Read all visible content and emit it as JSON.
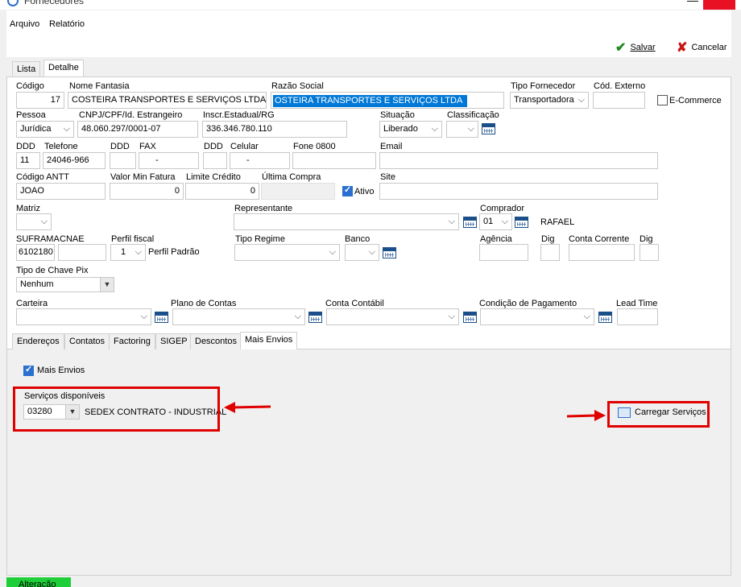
{
  "window": {
    "title": "Fornecedores"
  },
  "menu": [
    "Arquivo",
    "Relatório"
  ],
  "toolbar": {
    "save": "Salvar",
    "cancel": "Cancelar"
  },
  "main_tabs": [
    "Lista",
    "Detalhe"
  ],
  "fields": {
    "codigo": {
      "label": "Código",
      "value": "17"
    },
    "nome_fantasia": {
      "label": "Nome Fantasia",
      "value": "COSTEIRA TRANSPORTES E SERVIÇOS LTDA"
    },
    "razao_social": {
      "label": "Razão Social",
      "value": "OSTEIRA TRANSPORTES E SERVIÇOS LTDA"
    },
    "tipo_fornecedor": {
      "label": "Tipo Fornecedor",
      "value": "Transportadora"
    },
    "cod_externo": {
      "label": "Cód. Externo",
      "value": ""
    },
    "ecommerce": {
      "label": "E-Commerce",
      "checked": false
    },
    "pessoa": {
      "label": "Pessoa",
      "value": "Jurídica"
    },
    "cnpj": {
      "label": "CNPJ/CPF/Id. Estrangeiro",
      "value": "48.060.297/0001-07"
    },
    "inscr": {
      "label": "Inscr.Estadual/RG",
      "value": "336.346.780.110"
    },
    "situacao": {
      "label": "Situação",
      "value": "Liberado"
    },
    "classificacao": {
      "label": "Classificação",
      "value": ""
    },
    "ddd1": {
      "label": "DDD",
      "value": "11"
    },
    "telefone": {
      "label": "Telefone",
      "value": "24046-966"
    },
    "ddd2": {
      "label": "DDD",
      "value": ""
    },
    "fax": {
      "label": "FAX",
      "value": "-"
    },
    "ddd3": {
      "label": "DDD",
      "value": ""
    },
    "celular": {
      "label": "Celular",
      "value": "-"
    },
    "fone0800": {
      "label": "Fone 0800",
      "value": ""
    },
    "email": {
      "label": "Email",
      "value": ""
    },
    "antt": {
      "label": "Código ANTT",
      "value": "JOAO"
    },
    "valor_min": {
      "label": "Valor Min Fatura",
      "value": "0"
    },
    "limite": {
      "label": "Limite Crédito",
      "value": "0"
    },
    "ultima_compra": {
      "label": "Última Compra",
      "value": ""
    },
    "ativo": {
      "label": "Ativo",
      "checked": true
    },
    "site": {
      "label": "Site",
      "value": ""
    },
    "matriz": {
      "label": "Matriz",
      "value": ""
    },
    "representante": {
      "label": "Representante",
      "value": ""
    },
    "comprador": {
      "label": "Comprador",
      "value": "01",
      "name": "RAFAEL"
    },
    "suframa": {
      "label": "SUFRAMA",
      "value": "6102180"
    },
    "cnae": {
      "label": "CNAE",
      "value": ""
    },
    "perfil": {
      "label": "Perfil fiscal",
      "value": "1",
      "name": "Perfil Padrão"
    },
    "tipo_regime": {
      "label": "Tipo Regime",
      "value": ""
    },
    "banco": {
      "label": "Banco",
      "value": ""
    },
    "agencia": {
      "label": "Agência",
      "value": ""
    },
    "dig1": {
      "label": "Dig",
      "value": ""
    },
    "conta": {
      "label": "Conta Corrente",
      "value": ""
    },
    "dig2": {
      "label": "Dig",
      "value": ""
    },
    "pix": {
      "label": "Tipo de Chave Pix",
      "value": "Nenhum"
    },
    "carteira": {
      "label": "Carteira",
      "value": ""
    },
    "plano": {
      "label": "Plano de Contas",
      "value": ""
    },
    "contabil": {
      "label": "Conta Contábil",
      "value": ""
    },
    "pagamento": {
      "label": "Condição de Pagamento",
      "value": ""
    },
    "lead": {
      "label": "Lead Time",
      "value": ""
    }
  },
  "sub_tabs": [
    "Endereços",
    "Contatos",
    "Factoring",
    "SIGEP",
    "Descontos",
    "Mais Envios"
  ],
  "mais_envios": {
    "checkbox_label": "Mais Envios",
    "servicos_label": "Serviços disponíveis",
    "servico_code": "03280",
    "servico_desc": "SEDEX CONTRATO - INDUSTRIAL",
    "carregar": "Carregar Serviços"
  },
  "status": {
    "mode": "Alteração"
  },
  "colors": {
    "highlight": "#0078d7",
    "annotation": "#e00000",
    "status": "#1fcf3a"
  }
}
